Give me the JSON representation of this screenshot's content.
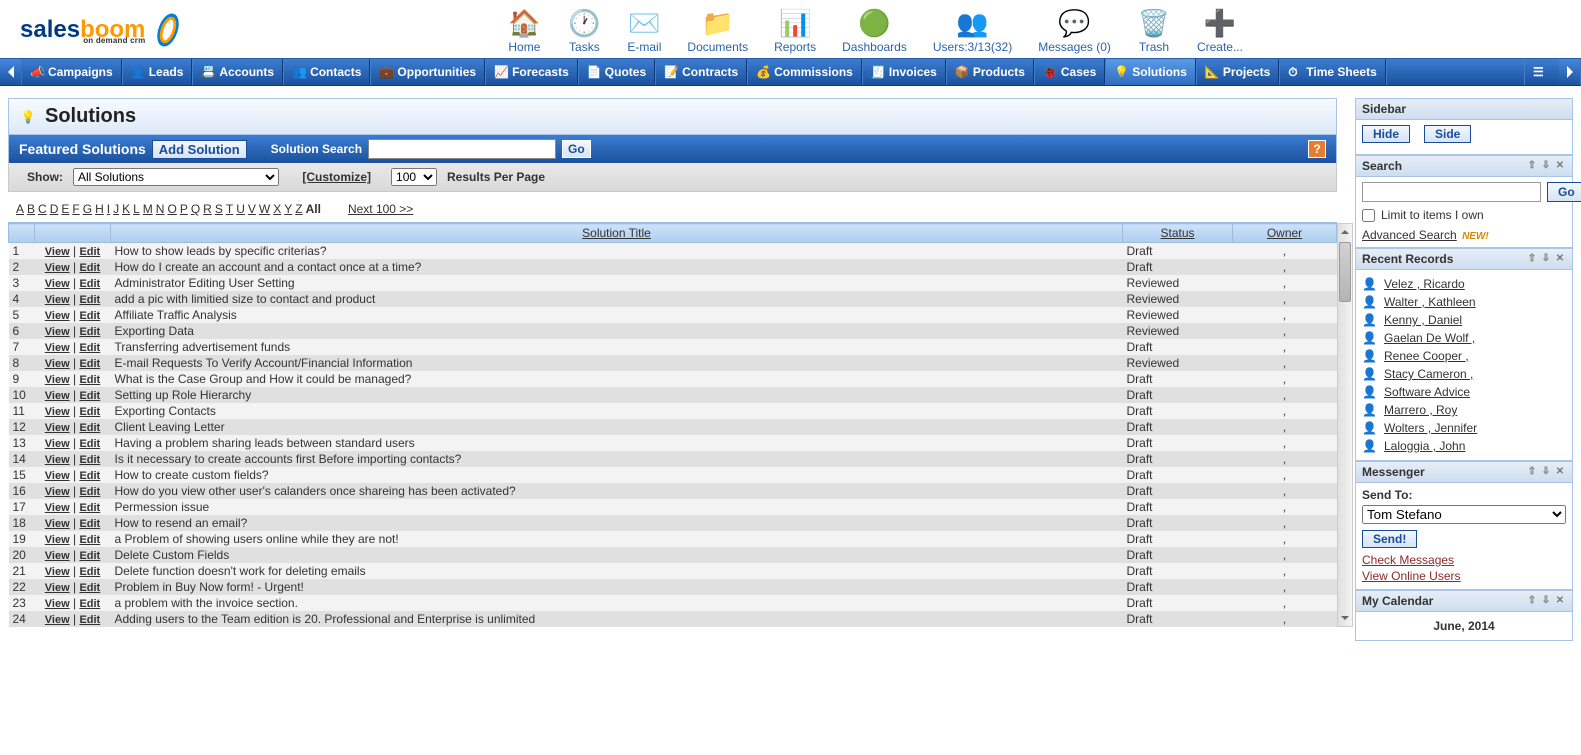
{
  "top_icons": [
    {
      "label": "Home",
      "emoji": "🏠"
    },
    {
      "label": "Tasks",
      "emoji": "🕐"
    },
    {
      "label": "E-mail",
      "emoji": "✉️"
    },
    {
      "label": "Documents",
      "emoji": "📁"
    },
    {
      "label": "Reports",
      "emoji": "📊"
    },
    {
      "label": "Dashboards",
      "emoji": "🟢"
    },
    {
      "label": "Users:3/13(32)",
      "emoji": "👥"
    },
    {
      "label": "Messages (0)",
      "emoji": "💬"
    },
    {
      "label": "Trash",
      "emoji": "🗑️"
    },
    {
      "label": "Create...",
      "emoji": "➕"
    }
  ],
  "nav": [
    "Campaigns",
    "Leads",
    "Accounts",
    "Contacts",
    "Opportunities",
    "Forecasts",
    "Quotes",
    "Contracts",
    "Commissions",
    "Invoices",
    "Products",
    "Cases",
    "Solutions",
    "Projects",
    "Time Sheets"
  ],
  "nav_active": "Solutions",
  "page_title": "Solutions",
  "action_bar": {
    "featured": "Featured Solutions",
    "add_button": "Add Solution",
    "search_label": "Solution Search",
    "go": "Go",
    "help": "?"
  },
  "filter": {
    "show_label": "Show:",
    "show_value": "All Solutions",
    "customize": "[Customize]",
    "per_page_value": "100",
    "per_page_label": "Results Per Page"
  },
  "alpha": [
    "A",
    "B",
    "C",
    "D",
    "E",
    "F",
    "G",
    "H",
    "I",
    "J",
    "K",
    "L",
    "M",
    "N",
    "O",
    "P",
    "Q",
    "R",
    "S",
    "T",
    "U",
    "V",
    "W",
    "X",
    "Y",
    "Z",
    "All"
  ],
  "next_100": "Next 100 >>",
  "columns": {
    "title": "Solution Title",
    "status": "Status",
    "owner": "Owner"
  },
  "rows": [
    {
      "n": "1",
      "title": "How to show leads by specific criterias?",
      "status": "Draft",
      "owner": ","
    },
    {
      "n": "2",
      "title": "How do I create an account and a contact once at a time?",
      "status": "Draft",
      "owner": ","
    },
    {
      "n": "3",
      "title": "Administrator Editing User Setting",
      "status": "Reviewed",
      "owner": ","
    },
    {
      "n": "4",
      "title": "add a pic with limitied size to contact and product",
      "status": "Reviewed",
      "owner": ","
    },
    {
      "n": "5",
      "title": "Affiliate Traffic Analysis",
      "status": "Reviewed",
      "owner": ","
    },
    {
      "n": "6",
      "title": "Exporting Data",
      "status": "Reviewed",
      "owner": ","
    },
    {
      "n": "7",
      "title": "Transferring advertisement funds",
      "status": "Draft",
      "owner": ","
    },
    {
      "n": "8",
      "title": "E-mail Requests To Verify Account/Financial Information",
      "status": "Reviewed",
      "owner": ","
    },
    {
      "n": "9",
      "title": "What is the Case Group and How it could be managed?",
      "status": "Draft",
      "owner": ","
    },
    {
      "n": "10",
      "title": "Setting up Role Hierarchy",
      "status": "Draft",
      "owner": ","
    },
    {
      "n": "11",
      "title": "Exporting Contacts",
      "status": "Draft",
      "owner": ","
    },
    {
      "n": "12",
      "title": "Client Leaving Letter",
      "status": "Draft",
      "owner": ","
    },
    {
      "n": "13",
      "title": "Having a problem sharing leads between standard users",
      "status": "Draft",
      "owner": ","
    },
    {
      "n": "14",
      "title": "Is it necessary to create accounts first Before importing contacts?",
      "status": "Draft",
      "owner": ","
    },
    {
      "n": "15",
      "title": "How to create custom fields?",
      "status": "Draft",
      "owner": ","
    },
    {
      "n": "16",
      "title": "How do you view other user's calanders once shareing has been activated?",
      "status": "Draft",
      "owner": ","
    },
    {
      "n": "17",
      "title": "Permession issue",
      "status": "Draft",
      "owner": ","
    },
    {
      "n": "18",
      "title": "How to resend an email?",
      "status": "Draft",
      "owner": ","
    },
    {
      "n": "19",
      "title": "a Problem of showing users online while they are not!",
      "status": "Draft",
      "owner": ","
    },
    {
      "n": "20",
      "title": "Delete Custom Fields",
      "status": "Draft",
      "owner": ","
    },
    {
      "n": "21",
      "title": "Delete function doesn't work for deleting emails",
      "status": "Draft",
      "owner": ","
    },
    {
      "n": "22",
      "title": "Problem in Buy Now form! - Urgent!",
      "status": "Draft",
      "owner": ","
    },
    {
      "n": "23",
      "title": "a problem with the invoice section.",
      "status": "Draft",
      "owner": ","
    },
    {
      "n": "24",
      "title": "Adding users to the Team edition is 20. Professional and Enterprise is unlimited",
      "status": "Draft",
      "owner": ","
    }
  ],
  "row_actions": {
    "view": "View",
    "edit": "Edit"
  },
  "sidebar": {
    "title": "Sidebar",
    "hide": "Hide",
    "side": "Side",
    "search_title": "Search",
    "go": "Go",
    "limit_label": "Limit to items I own",
    "adv_search": "Advanced Search",
    "new_badge": "NEW!",
    "recent_title": "Recent Records",
    "recent": [
      "Velez , Ricardo",
      "Walter , Kathleen",
      "Kenny , Daniel",
      "Gaelan De Wolf ,",
      "Renee Cooper ,",
      "Stacy Cameron ,",
      "Software Advice",
      "Marrero , Roy",
      "Wolters , Jennifer",
      "Laloggia , John"
    ],
    "messenger_title": "Messenger",
    "send_to": "Send To:",
    "send_to_value": "Tom Stefano",
    "send_btn": "Send!",
    "check_msgs": "Check Messages",
    "view_online": "View Online Users",
    "calendar_title": "My Calendar",
    "calendar_month": "June, 2014"
  }
}
